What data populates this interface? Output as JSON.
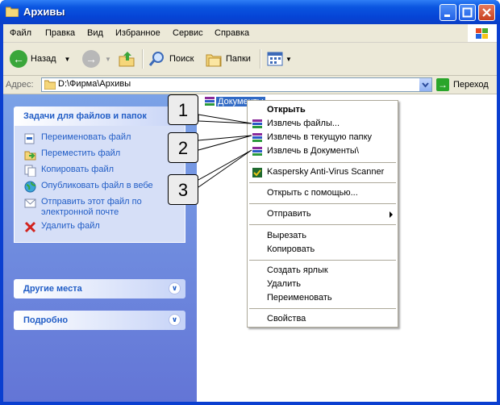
{
  "window": {
    "title": "Архивы"
  },
  "menubar": {
    "items": [
      "Файл",
      "Правка",
      "Вид",
      "Избранное",
      "Сервис",
      "Справка"
    ]
  },
  "toolbar": {
    "back": "Назад",
    "search": "Поиск",
    "folders": "Папки"
  },
  "address": {
    "label": "Адрес:",
    "value": "D:\\Фирма\\Архивы",
    "go": "Переход"
  },
  "taskpane": {
    "file_tasks": {
      "title": "Задачи для файлов и папок",
      "items": [
        "Переименовать файл",
        "Переместить файл",
        "Копировать файл",
        "Опубликовать файл в вебе",
        "Отправить этот файл по электронной почте",
        "Удалить файл"
      ]
    },
    "other_places": {
      "title": "Другие места"
    },
    "details": {
      "title": "Подробно"
    }
  },
  "file": {
    "name": "Документы"
  },
  "context_menu": {
    "open": "Открыть",
    "extract_files": "Извлечь файлы...",
    "extract_here": "Извлечь в текущую папку",
    "extract_to": "Извлечь в Документы\\",
    "kaspersky": "Kaspersky Anti-Virus Scanner",
    "open_with": "Открыть с помощью...",
    "send_to": "Отправить",
    "cut": "Вырезать",
    "copy": "Копировать",
    "create_shortcut": "Создать ярлык",
    "delete": "Удалить",
    "rename": "Переименовать",
    "properties": "Свойства"
  },
  "callouts": [
    "1",
    "2",
    "3"
  ],
  "colors": {
    "title_bar": "#0a55e0",
    "selection": "#316ac5",
    "task_link": "#215dc6",
    "taskpane": "#6f8fe0"
  }
}
